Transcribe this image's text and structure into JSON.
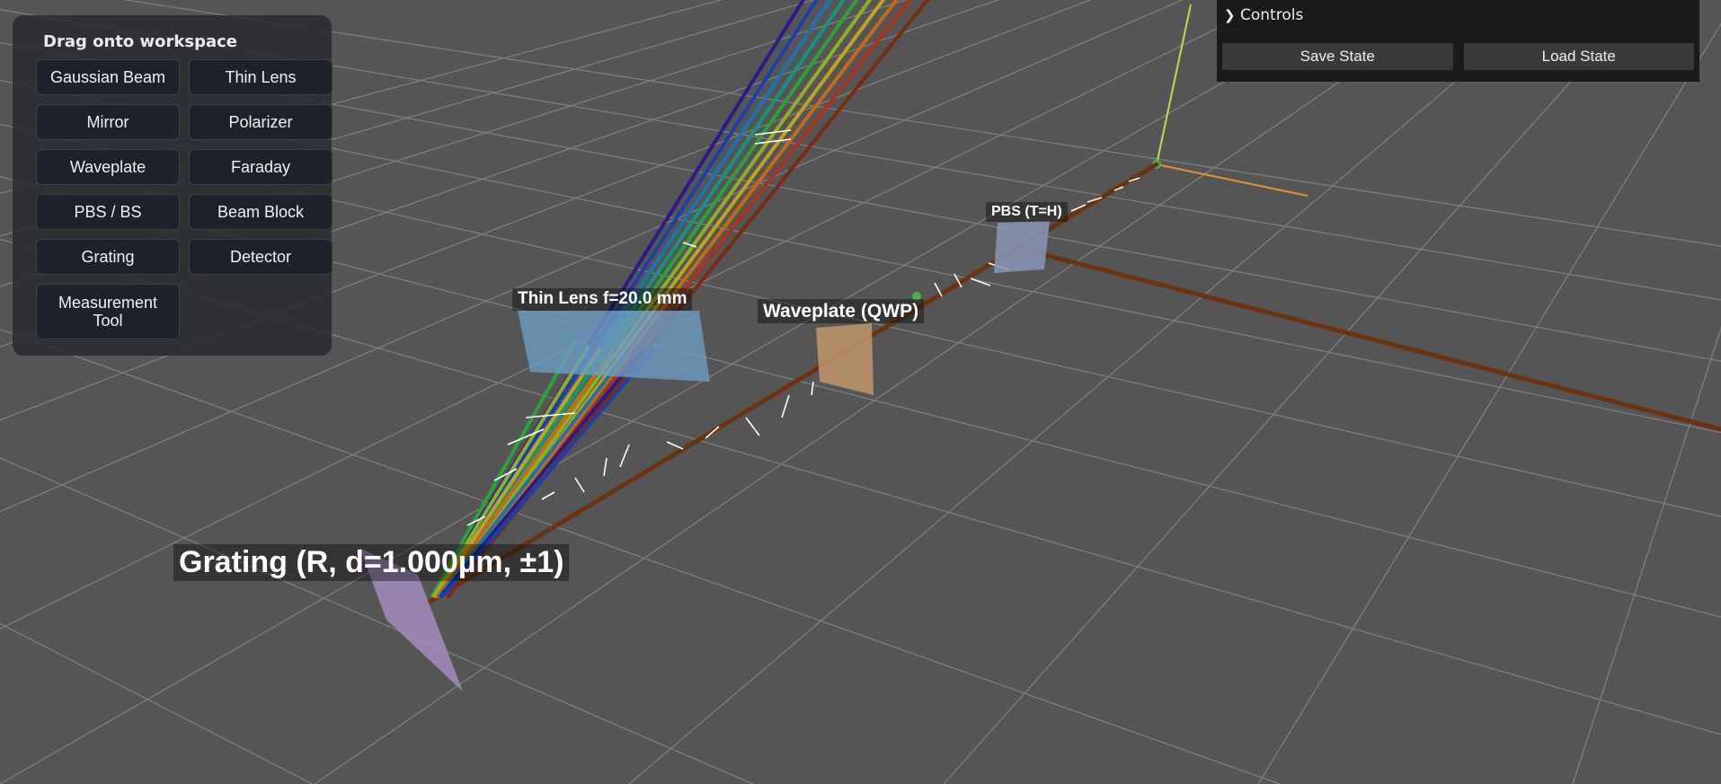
{
  "palette": {
    "title": "Drag onto workspace",
    "items": [
      {
        "label": "Gaussian Beam"
      },
      {
        "label": "Thin Lens"
      },
      {
        "label": "Mirror"
      },
      {
        "label": "Polarizer"
      },
      {
        "label": "Waveplate"
      },
      {
        "label": "Faraday"
      },
      {
        "label": "PBS / BS"
      },
      {
        "label": "Beam Block"
      },
      {
        "label": "Grating"
      },
      {
        "label": "Detector"
      },
      {
        "label": "Measurement Tool"
      }
    ]
  },
  "controls": {
    "title": "Controls",
    "save_label": "Save State",
    "load_label": "Load State"
  },
  "labels": {
    "grating": "Grating (R, d=1.000µm, ±1)",
    "lens": "Thin Lens f=20.0 mm",
    "waveplate": "Waveplate (QWP)",
    "pbs": "PBS (T=H)"
  },
  "colors": {
    "background": "#555555",
    "grid": "#8a8a8a",
    "beam": "#6b3210",
    "lens_fill": "#6d9cc4",
    "waveplate_fill": "#c59a6c",
    "grating_fill": "#a48dc0",
    "pbs_fill": "#8a96b8"
  }
}
